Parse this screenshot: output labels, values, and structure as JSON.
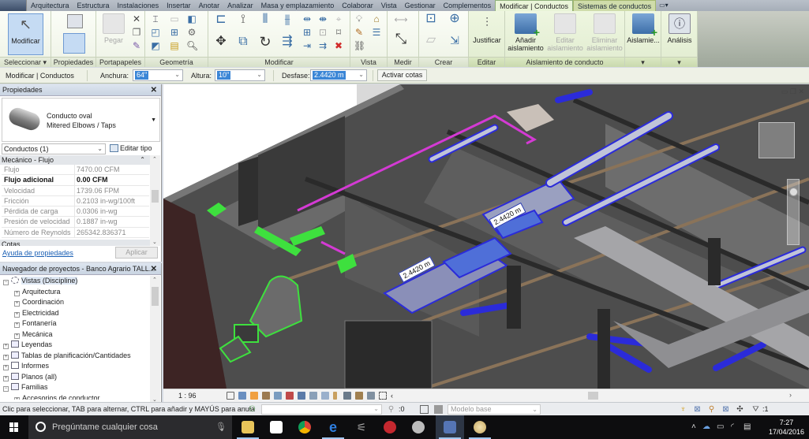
{
  "app": {
    "name": "Autodesk Revit",
    "ribbon_tabs": [
      {
        "label": "Arquitectura"
      },
      {
        "label": "Estructura"
      },
      {
        "label": "Instalaciones"
      },
      {
        "label": "Insertar"
      },
      {
        "label": "Anotar"
      },
      {
        "label": "Analizar"
      },
      {
        "label": "Masa y emplazamiento"
      },
      {
        "label": "Colaborar"
      },
      {
        "label": "Vista"
      },
      {
        "label": "Gestionar"
      },
      {
        "label": "Complementos"
      },
      {
        "label": "Modificar | Conductos",
        "active": true
      },
      {
        "label": "Sistemas de conductos",
        "contextual": true
      }
    ],
    "ribbon_panels": {
      "seleccionar": {
        "label": "Seleccionar",
        "button": "Modificar"
      },
      "propiedades": {
        "label": "Propiedades"
      },
      "portapapeles": {
        "label": "Portapapeles",
        "paste": "Pegar"
      },
      "geometria": {
        "label": "Geometría"
      },
      "modificar": {
        "label": "Modificar"
      },
      "vista": {
        "label": "Vista"
      },
      "medir": {
        "label": "Medir"
      },
      "crear": {
        "label": "Crear"
      },
      "editar": {
        "label": "Editar",
        "button": "Justificar"
      },
      "aislamiento": {
        "label": "Aislamiento de conducto",
        "add_line1": "Añadir",
        "add_line2": "aislamiento",
        "edit_line1": "Editar",
        "edit_line2": "aislamiento",
        "del_line1": "Eliminar",
        "del_line2": "aislamiento"
      },
      "aislamie": {
        "button": "Aislamie..."
      },
      "analisis": {
        "button": "Análisis"
      }
    }
  },
  "options_bar": {
    "context": "Modificar | Conductos",
    "width_label": "Anchura:",
    "width_value": "64\"",
    "height_label": "Altura:",
    "height_value": "10\"",
    "offset_label": "Desfase:",
    "offset_value": "2.4420 m",
    "dimensions_button": "Activar cotas"
  },
  "properties": {
    "title": "Propiedades",
    "type_line1": "Conducto oval",
    "type_line2": "Mitered Elbows / Taps",
    "instance_filter": "Conductos (1)",
    "edit_type": "Editar tipo",
    "group": "Mecánico - Flujo",
    "rows": [
      {
        "key": "Flujo",
        "value": "7470.00 CFM",
        "bold": false
      },
      {
        "key": "Flujo adicional",
        "value": "0.00 CFM",
        "bold": true
      },
      {
        "key": "Velocidad",
        "value": "1739.06 FPM",
        "bold": false
      },
      {
        "key": "Fricción",
        "value": "0.2103 in-wg/100ft",
        "bold": false
      },
      {
        "key": "Pérdida de carga",
        "value": "0.0306 in-wg",
        "bold": false
      },
      {
        "key": "Presión de velocidad",
        "value": "0.1887 in-wg",
        "bold": false
      },
      {
        "key": "Número de Reynolds",
        "value": "265342.836371",
        "bold": false
      }
    ],
    "next_group": "Cotas",
    "help_link": "Ayuda de propiedades",
    "apply": "Aplicar"
  },
  "project_browser": {
    "title": "Navegador de proyectos - Banco Agrario TALL...",
    "nodes": [
      {
        "label": "Vistas (Discipline)",
        "level": 0,
        "expanded": true,
        "selected": true
      },
      {
        "label": "Arquitectura",
        "level": 1
      },
      {
        "label": "Coordinación",
        "level": 1
      },
      {
        "label": "Electricidad",
        "level": 1
      },
      {
        "label": "Fontanería",
        "level": 1
      },
      {
        "label": "Mecánica",
        "level": 1
      },
      {
        "label": "Leyendas",
        "level": 0
      },
      {
        "label": "Tablas de planificación/Cantidades",
        "level": 0
      },
      {
        "label": "Informes",
        "level": 0
      },
      {
        "label": "Planos (all)",
        "level": 0
      },
      {
        "label": "Familias",
        "level": 0,
        "expanded": true
      },
      {
        "label": "Accesorios de conductor",
        "level": 1
      }
    ]
  },
  "viewport": {
    "dimension_tags": [
      "2.4420 m",
      "2.4420 m"
    ],
    "scale": "1 : 96",
    "colors": {
      "selected_duct": "#2b2bd9",
      "green_duct": "#3ee03e",
      "magenta_pipe": "#d43ad4"
    }
  },
  "status_bar": {
    "message": "Clic para seleccionar, TAB para alternar, CTRL para añadir y MAYÚS para anula",
    "worksets_value": "",
    "count": ":0",
    "design_option": "Modelo base",
    "filter_count": ":1"
  },
  "taskbar": {
    "search_placeholder": "Pregúntame cualquier cosa",
    "time": "7:27",
    "date": "17/04/2016",
    "apps": [
      "file-explorer",
      "store",
      "chrome",
      "edge",
      "app-5",
      "app-6",
      "app-7",
      "revit",
      "paint"
    ]
  }
}
